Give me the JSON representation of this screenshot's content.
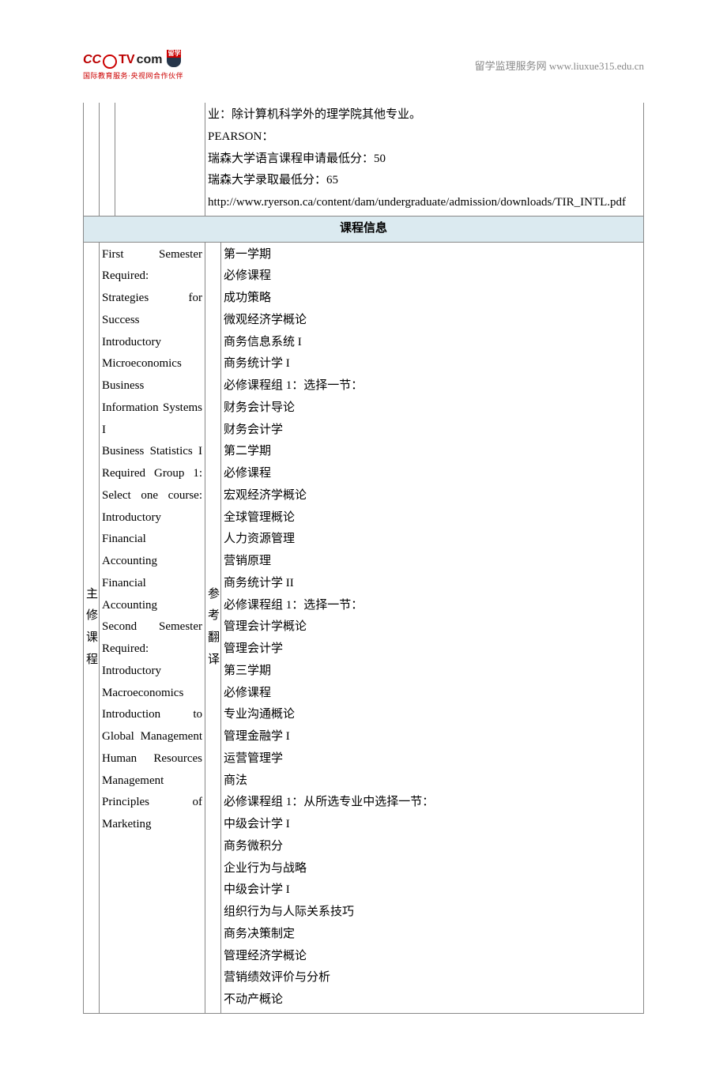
{
  "header": {
    "logo_text_1": "CC",
    "logo_text_2": "TV",
    "logo_text_3": "com",
    "logo_badge": "留学",
    "logo_subtitle": "国际教育服务·央视网合作伙伴",
    "right_text": "留学监理服务网 www.liuxue315.edu.cn"
  },
  "top_cell": {
    "line1": "业：除计算机科学外的理学院其他专业。",
    "line2": "PEARSON：",
    "line3": "瑞森大学语言课程申请最低分：50",
    "line4": "瑞森大学录取最低分：65",
    "line5": "http://www.ryerson.ca/content/dam/undergraduate/admission/downloads/TIR_INTL.pdf"
  },
  "section_title": "课程信息",
  "row_labels": {
    "main": "主修课程",
    "ref": "参考翻译"
  },
  "english_lines": [
    "First Semester",
    "Required:",
    "Strategies for Success",
    "Introductory Microeconomics",
    "Business Information Systems I",
    "Business Statistics I",
    "Required Group 1: Select one course:",
    "Introductory Financial Accounting",
    "Financial Accounting",
    "Second Semester",
    "Required:",
    "Introductory Macroeconomics",
    "Introduction to Global Management",
    "Human Resources Management",
    "Principles of Marketing"
  ],
  "chinese_lines": [
    "第一学期",
    "必修课程",
    "成功策略",
    "微观经济学概论",
    "商务信息系统 I",
    "商务统计学 I",
    "必修课程组 1：选择一节：",
    "财务会计导论",
    "财务会计学",
    "第二学期",
    "必修课程",
    "宏观经济学概论",
    "全球管理概论",
    "人力资源管理",
    "营销原理",
    "商务统计学 II",
    "必修课程组 1：选择一节：",
    "管理会计学概论",
    "管理会计学",
    "第三学期",
    "必修课程",
    "专业沟通概论",
    "管理金融学 I",
    "运营管理学",
    "商法",
    "必修课程组 1：从所选专业中选择一节：",
    "中级会计学 I",
    "商务微积分",
    "企业行为与战略",
    "中级会计学 I",
    "组织行为与人际关系技巧",
    "商务决策制定",
    "管理经济学概论",
    "营销绩效评价与分析",
    "不动产概论"
  ]
}
